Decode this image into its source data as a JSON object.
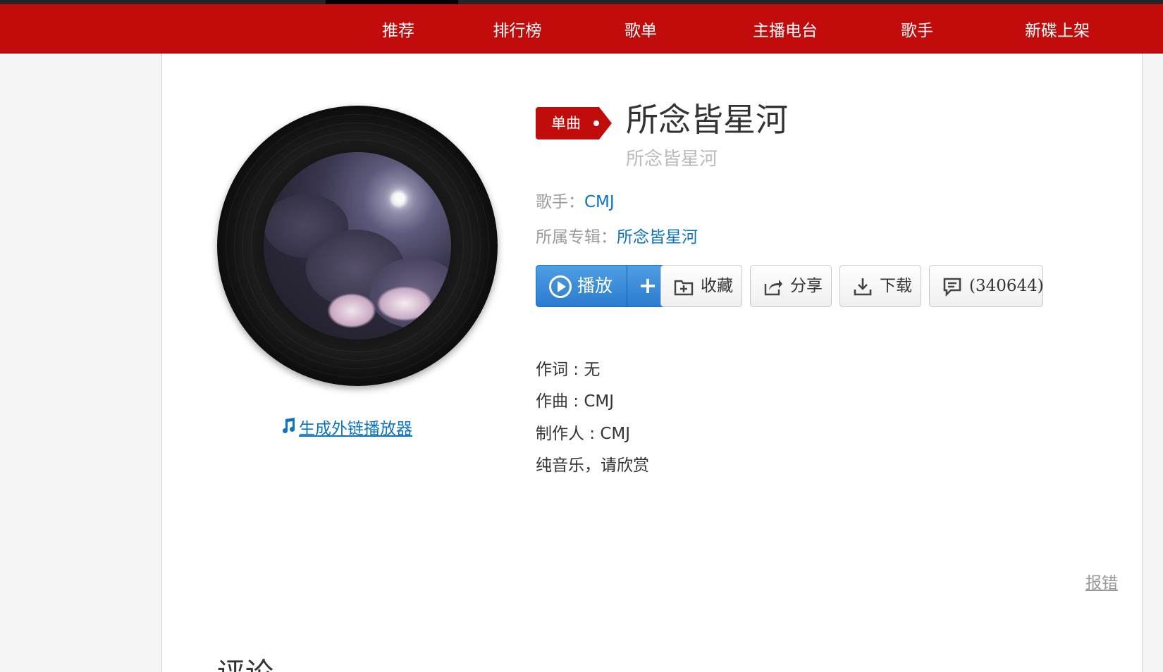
{
  "nav": {
    "items": [
      "推荐",
      "排行榜",
      "歌单",
      "主播电台",
      "歌手",
      "新碟上架"
    ],
    "active": "推荐"
  },
  "song": {
    "badge": "单曲",
    "title": "所念皆星河",
    "subtitle": "所念皆星河",
    "artist_label": "歌手：",
    "artist": "CMJ",
    "album_label": "所属专辑：",
    "album": "所念皆星河"
  },
  "external_player": {
    "label": "生成外链播放器",
    "icon": "music-note-icon"
  },
  "actions": {
    "play_label": "播放",
    "add_label": "+",
    "collect_label": "收藏",
    "share_label": "分享",
    "download_label": "下载",
    "comment_label": "(340644)"
  },
  "lyrics": {
    "lines": [
      "作词 : 无",
      "作曲 : CMJ",
      "制作人 : CMJ",
      "纯音乐，请欣赏"
    ]
  },
  "report_label": "报错",
  "comments_title": "评论",
  "colors": {
    "brand_red": "#c20c0c",
    "link_blue": "#0c73c2",
    "play_blue": "#2b7cd0"
  }
}
